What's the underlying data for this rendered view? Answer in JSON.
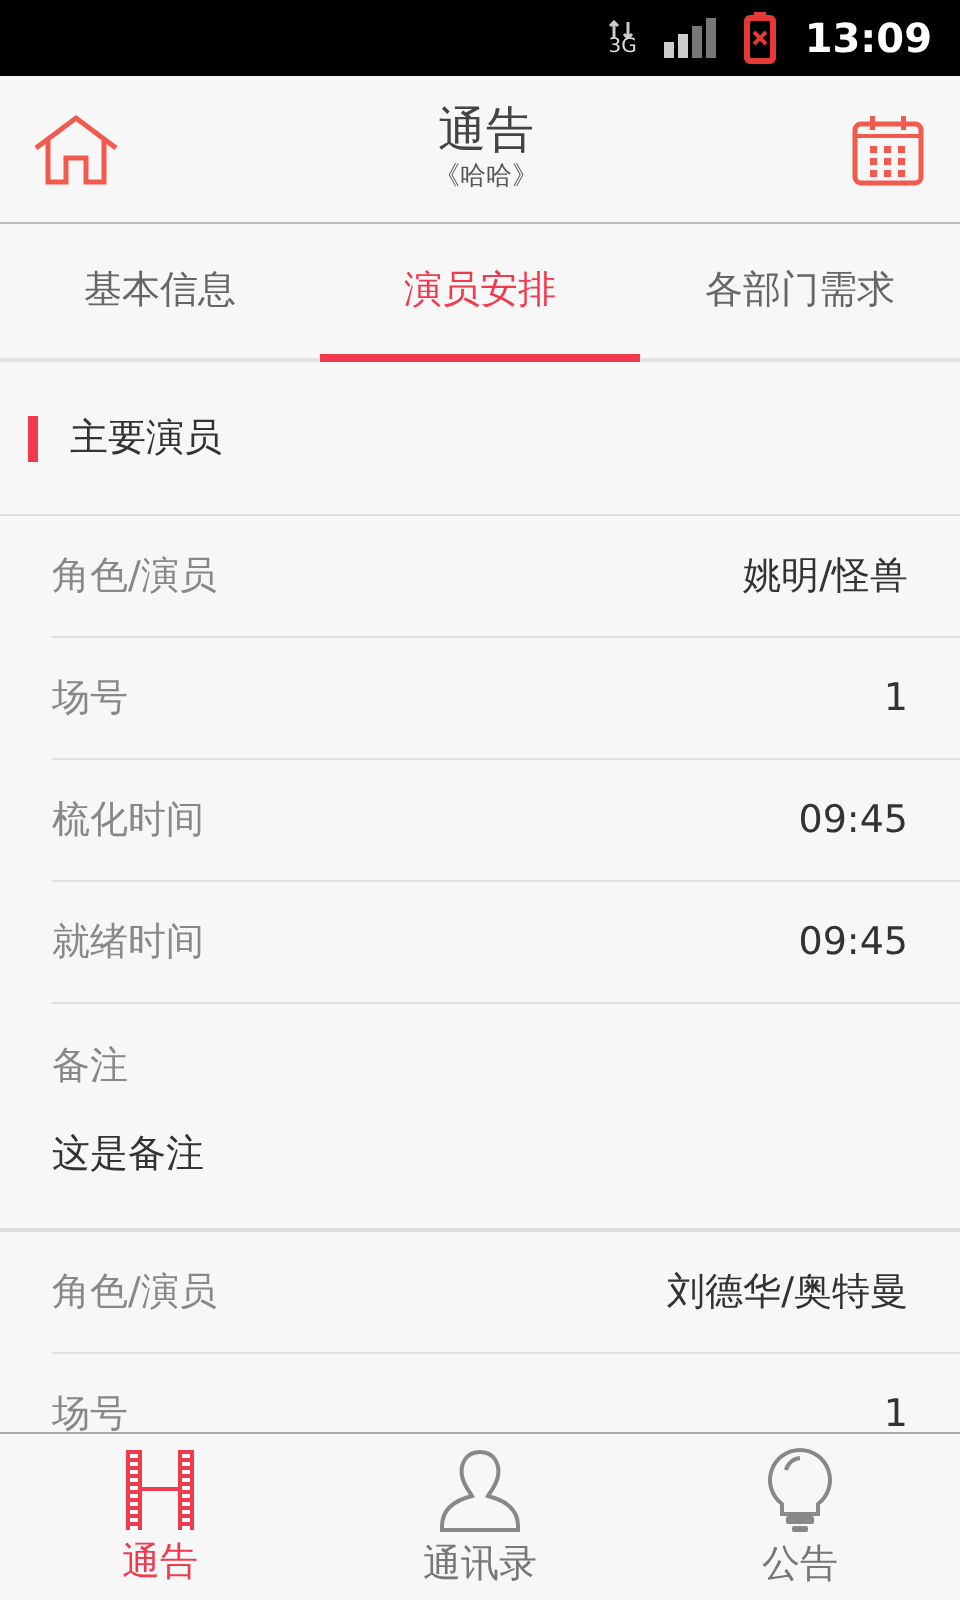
{
  "status_bar": {
    "network": "3G",
    "time": "13:09"
  },
  "header": {
    "title": "通告",
    "subtitle": "《哈哈》"
  },
  "tabs": [
    {
      "label": "基本信息",
      "selected": false
    },
    {
      "label": "演员安排",
      "selected": true
    },
    {
      "label": "各部门需求",
      "selected": false
    }
  ],
  "section": {
    "title": "主要演员"
  },
  "groups": [
    {
      "rows": [
        {
          "label": "角色/演员",
          "value": "姚明/怪兽"
        },
        {
          "label": "场号",
          "value": "1"
        },
        {
          "label": "梳化时间",
          "value": "09:45"
        },
        {
          "label": "就绪时间",
          "value": "09:45"
        }
      ],
      "note": {
        "label": "备注",
        "text": "这是备注"
      }
    },
    {
      "rows": [
        {
          "label": "角色/演员",
          "value": "刘德华/奥特曼"
        },
        {
          "label": "场号",
          "value": "1"
        }
      ]
    }
  ],
  "bottom_nav": [
    {
      "kind": "film",
      "label": "通告",
      "selected": true
    },
    {
      "kind": "person",
      "label": "通讯录",
      "selected": false
    },
    {
      "kind": "bulb",
      "label": "公告",
      "selected": false
    }
  ]
}
